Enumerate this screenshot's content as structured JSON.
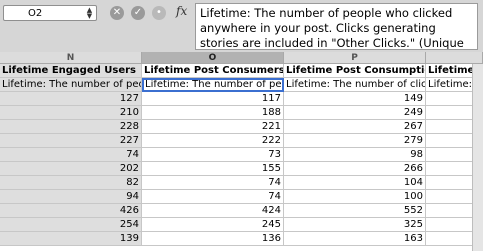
{
  "formula_bar": {
    "name_box": "O2",
    "cancel_icon": "cancel-icon",
    "enter_icon": "enter-icon",
    "function_icon": "function-icon",
    "fx_label": "fx",
    "content": "Lifetime: The number of people who clicked anywhere in your post. Clicks generating stories are included in \"Other Clicks.\" (Unique Users)"
  },
  "columns": [
    {
      "letter": "N",
      "header": "Lifetime Engaged Users",
      "desc": "Lifetime: The number of peo",
      "values": [
        "127",
        "210",
        "228",
        "227",
        "74",
        "202",
        "82",
        "94",
        "426",
        "254",
        "139"
      ]
    },
    {
      "letter": "O",
      "header": "Lifetime Post Consumers",
      "desc": "Lifetime: The number of peo",
      "values": [
        "117",
        "188",
        "221",
        "222",
        "73",
        "155",
        "74",
        "74",
        "424",
        "245",
        "136"
      ]
    },
    {
      "letter": "P",
      "header": "Lifetime Post Consumptio",
      "desc": "Lifetime: The number of click",
      "values": [
        "149",
        "249",
        "267",
        "279",
        "98",
        "266",
        "104",
        "100",
        "552",
        "325",
        "163"
      ]
    },
    {
      "letter": "",
      "header": "Lifetime N",
      "desc": "Lifetime: T",
      "values": []
    }
  ],
  "colors": {
    "selected_border": "#3b6fd0",
    "header_bg": "#dcdcdc",
    "gray_column": "#dedede"
  }
}
